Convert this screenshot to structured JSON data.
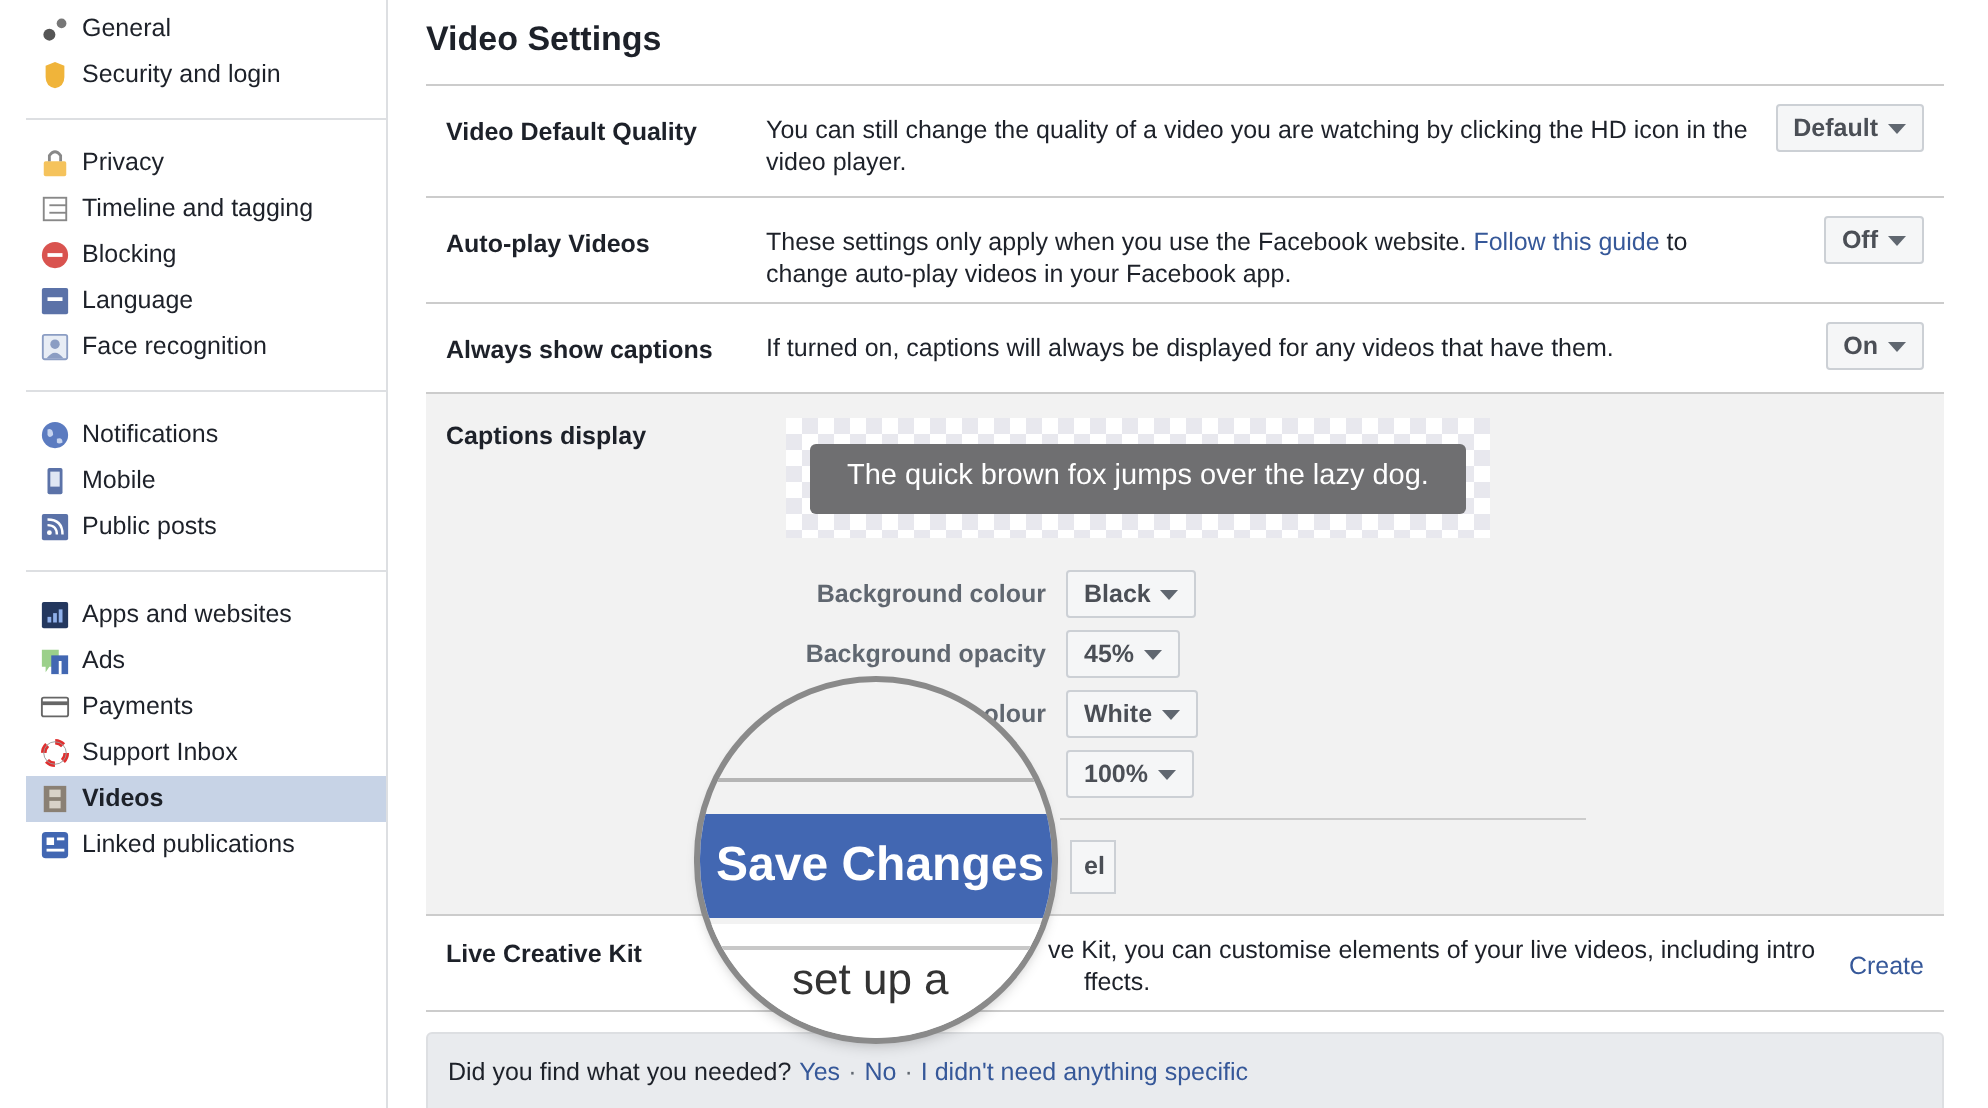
{
  "sidebar": {
    "groups": [
      {
        "items": [
          {
            "label": "General",
            "selected": false
          },
          {
            "label": "Security and login",
            "selected": false
          }
        ]
      },
      {
        "items": [
          {
            "label": "Privacy",
            "selected": false
          },
          {
            "label": "Timeline and tagging",
            "selected": false
          },
          {
            "label": "Blocking",
            "selected": false
          },
          {
            "label": "Language",
            "selected": false
          },
          {
            "label": "Face recognition",
            "selected": false
          }
        ]
      },
      {
        "items": [
          {
            "label": "Notifications",
            "selected": false
          },
          {
            "label": "Mobile",
            "selected": false
          },
          {
            "label": "Public posts",
            "selected": false
          }
        ]
      },
      {
        "items": [
          {
            "label": "Apps and websites",
            "selected": false
          },
          {
            "label": "Ads",
            "selected": false
          },
          {
            "label": "Payments",
            "selected": false
          },
          {
            "label": "Support Inbox",
            "selected": false
          },
          {
            "label": "Videos",
            "selected": true
          },
          {
            "label": "Linked publications",
            "selected": false
          }
        ]
      }
    ]
  },
  "page_title": "Video Settings",
  "settings": [
    {
      "label": "Video Default Quality",
      "description": "You can still change the quality of a video you are watching by clicking the HD icon in the video player.",
      "value": "Default"
    },
    {
      "label": "Auto-play Videos",
      "description": "These settings only apply when you use the Facebook website.",
      "link": "Follow this guide",
      "description_end": "to change auto-play videos in your Facebook app.",
      "value": "Off"
    },
    {
      "label": "Always show captions",
      "description": "If turned on, captions will always be displayed for any videos that have them.",
      "value": "On"
    }
  ],
  "captions_display": {
    "label": "Captions display",
    "preview_text": "The quick brown fox jumps over the lazy dog.",
    "options": [
      {
        "label": "Background colour",
        "value": "Black"
      },
      {
        "label": "Background opacity",
        "value": "45%"
      },
      {
        "label": "olour",
        "value": "White"
      },
      {
        "value": "100%"
      }
    ],
    "cancel_button": "el"
  },
  "live_creative_kit": {
    "label": "Live Creative Kit",
    "description_lines": [
      "ve Kit, you can customise elements of your live videos, including intro",
      "ffects."
    ],
    "action": "Create"
  },
  "magnifier": {
    "button": "Save Changes",
    "text": "set up a"
  },
  "feedback": {
    "question": "Did you find what you needed?",
    "links": [
      "Yes",
      "No",
      "I didn't need anything specific"
    ],
    "separator": "·"
  }
}
